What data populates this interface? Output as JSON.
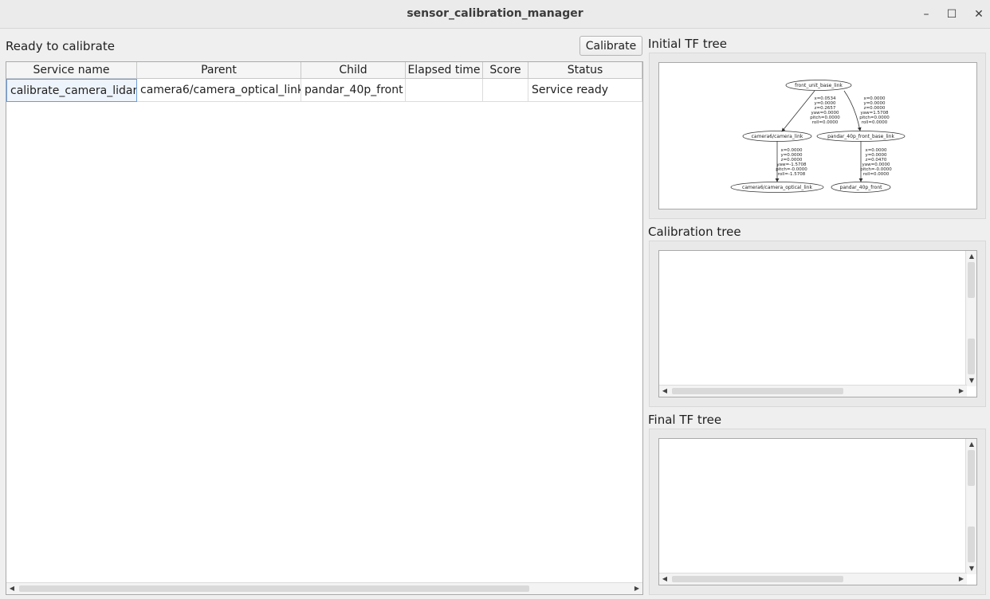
{
  "window": {
    "title": "sensor_calibration_manager",
    "minimize": "–",
    "maximize": "☐",
    "close": "✕"
  },
  "status_label": "Ready to calibrate",
  "calibrate_button": "Calibrate",
  "table": {
    "columns": [
      "Service name",
      "Parent",
      "Child",
      "Elapsed time",
      "Score",
      "Status"
    ],
    "rows": [
      {
        "service_name": "calibrate_camera_lidar",
        "parent": "camera6/camera_optical_link",
        "child": "pandar_40p_front",
        "elapsed_time": "",
        "score": "",
        "status": "Service ready"
      }
    ]
  },
  "panels": {
    "initial": "Initial TF tree",
    "calibration": "Calibration tree",
    "final": "Final TF tree"
  },
  "tf_tree": {
    "nodes": {
      "root": "front_unit_base_link",
      "cam": "camera6/camera_link",
      "cam_opt": "camera6/camera_optical_link",
      "pandar_base": "pandar_40p_front_base_link",
      "pandar": "pandar_40p_front"
    },
    "edge_root_cam": [
      "x=0.0534",
      "y=0.0000",
      "z=0.2657",
      "yaw=0.0000",
      "pitch=0.0000",
      "roll=0.0000"
    ],
    "edge_root_pandar": [
      "x=0.0000",
      "y=0.0000",
      "z=0.0000",
      "yaw=1.5708",
      "pitch=0.0000",
      "roll=0.0000"
    ],
    "edge_cam_opt": [
      "x=0.0000",
      "y=0.0000",
      "z=0.0000",
      "yaw=-1.5708",
      "pitch=-0.0000",
      "roll=-1.5708"
    ],
    "edge_pandar": [
      "x=0.0000",
      "y=0.0000",
      "z=0.0470",
      "yaw=0.0000",
      "pitch=-0.0000",
      "roll=0.0000"
    ]
  }
}
